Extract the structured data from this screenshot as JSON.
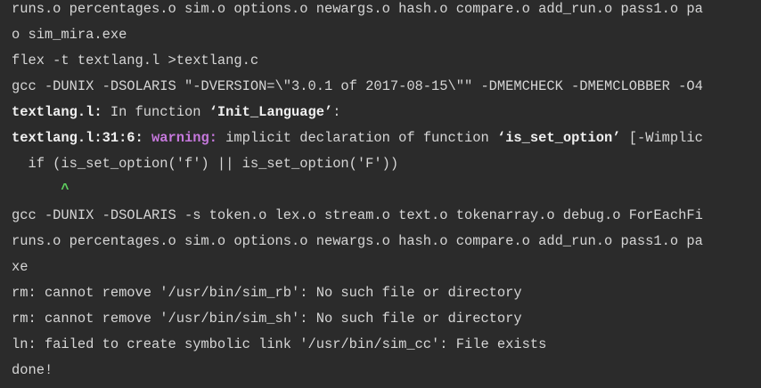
{
  "terminal": {
    "lines": [
      {
        "text": "runs.o percentages.o sim.o options.o newargs.o hash.o compare.o add_run.o pass1.o pa"
      },
      {
        "text": "o sim_mira.exe"
      },
      {
        "text": "flex -t textlang.l >textlang.c"
      },
      {
        "text": "gcc -DUNIX -DSOLARIS \"-DVERSION=\\\"3.0.1 of 2017-08-15\\\"\" -DMEMCHECK -DMEMCLOBBER -O4"
      },
      {
        "seg1": "textlang.l:",
        "seg2": " In function ",
        "seg3": "‘Init_Language’",
        "seg4": ":"
      },
      {
        "seg1": "textlang.l:31:6:",
        "seg2": " ",
        "seg3": "warning:",
        "seg4": " implicit declaration of function ",
        "seg5": "‘is_set_option’",
        "seg6": " [-Wimplic"
      },
      {
        "text": "  if (is_set_option('f') || is_set_option('F'))"
      },
      {
        "text": "      ^"
      },
      {
        "text": "gcc -DUNIX -DSOLARIS -s token.o lex.o stream.o text.o tokenarray.o debug.o ForEachFi"
      },
      {
        "text": "runs.o percentages.o sim.o options.o newargs.o hash.o compare.o add_run.o pass1.o pa"
      },
      {
        "text": "xe"
      },
      {
        "text": "rm: cannot remove '/usr/bin/sim_rb': No such file or directory"
      },
      {
        "text": "rm: cannot remove '/usr/bin/sim_sh': No such file or directory"
      },
      {
        "text": "ln: failed to create symbolic link '/usr/bin/sim_cc': File exists"
      },
      {
        "text": "done!"
      }
    ]
  },
  "colors": {
    "background": "#2b2b2b",
    "foreground": "#d6d6d6",
    "warning": "#c678dd",
    "caret": "#5fd35f"
  }
}
